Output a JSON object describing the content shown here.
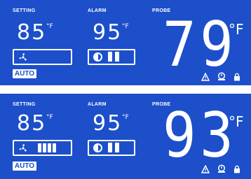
{
  "panels": [
    {
      "setting_label": "SETTING",
      "alarm_label": "ALARM",
      "probe_label": "PROBE",
      "setting_value": "85",
      "setting_unit": "°F",
      "alarm_value": "95",
      "alarm_unit": "°F",
      "probe_value": "79",
      "probe_unit": "°F",
      "fan_level_bars": 0,
      "auto_label": "AUTO",
      "status_icons": [
        "warning-icon",
        "timer-icon",
        "lock-icon"
      ]
    },
    {
      "setting_label": "SETTING",
      "alarm_label": "ALARM",
      "probe_label": "PROBE",
      "setting_value": "85",
      "setting_unit": "°F",
      "alarm_value": "95",
      "alarm_unit": "°F",
      "probe_value": "93",
      "probe_unit": "°F",
      "fan_level_bars": 4,
      "auto_label": "AUTO",
      "status_icons": [
        "warning-icon",
        "timer-icon",
        "lock-icon"
      ]
    }
  ],
  "colors": {
    "background": "#1c4fc9",
    "foreground": "#ffffff"
  }
}
